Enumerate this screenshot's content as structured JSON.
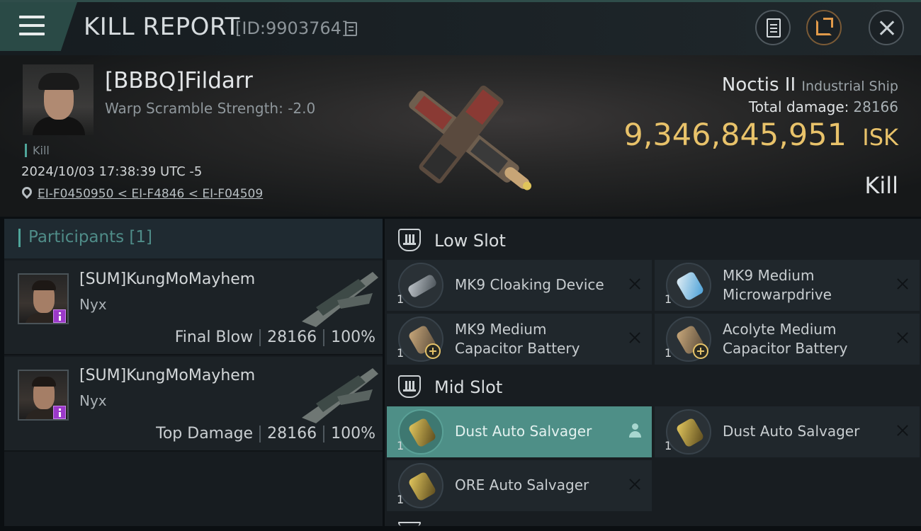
{
  "header": {
    "title": "KILL REPORT",
    "report_id": "[ID:9903764]",
    "icons": [
      "menu-icon",
      "copy-icon",
      "clipboard-icon",
      "share-icon",
      "close-icon"
    ]
  },
  "victim": {
    "name": "[BBBQ]Fildarr",
    "warp_scramble": "Warp Scramble Strength: -2.0",
    "tag": "Kill",
    "timestamp": "2024/10/03 17:38:39 UTC -5",
    "location": "EI-F0450950 < EI-F4846 < EI-F04509",
    "ship_name": "Noctis II",
    "ship_class": "Industrial Ship",
    "total_damage_label": "Total damage:",
    "total_damage": "28166",
    "isk_value": "9,346,845,951",
    "isk_label": "ISK",
    "result": "Kill"
  },
  "participants": {
    "title": "Participants [1]",
    "items": [
      {
        "name": "[SUM]KungMoMayhem",
        "ship": "Nyx",
        "role": "Final Blow",
        "damage": "28166",
        "percent": "100%"
      },
      {
        "name": "[SUM]KungMoMayhem",
        "ship": "Nyx",
        "role": "Top Damage",
        "damage": "28166",
        "percent": "100%"
      }
    ]
  },
  "slots": {
    "low": {
      "title": "Low Slot",
      "modules": [
        {
          "qty": "1",
          "line1": "MK9 Cloaking Device",
          "line2": ""
        },
        {
          "qty": "1",
          "line1": "MK9 Medium",
          "line2": "Microwarpdrive"
        },
        {
          "qty": "1",
          "line1": "MK9 Medium",
          "line2": "Capacitor Battery"
        },
        {
          "qty": "1",
          "line1": "Acolyte Medium",
          "line2": "Capacitor Battery"
        }
      ]
    },
    "mid": {
      "title": "Mid Slot",
      "modules": [
        {
          "qty": "1",
          "line1": "Dust Auto Salvager",
          "line2": ""
        },
        {
          "qty": "1",
          "line1": "Dust Auto Salvager",
          "line2": ""
        },
        {
          "qty": "1",
          "line1": "ORE Auto Salvager",
          "line2": ""
        }
      ]
    }
  },
  "colors": {
    "accent_teal": "#4e8f87",
    "isk_gold": "#e8c26a",
    "drone_badge": "#9b38c9"
  }
}
